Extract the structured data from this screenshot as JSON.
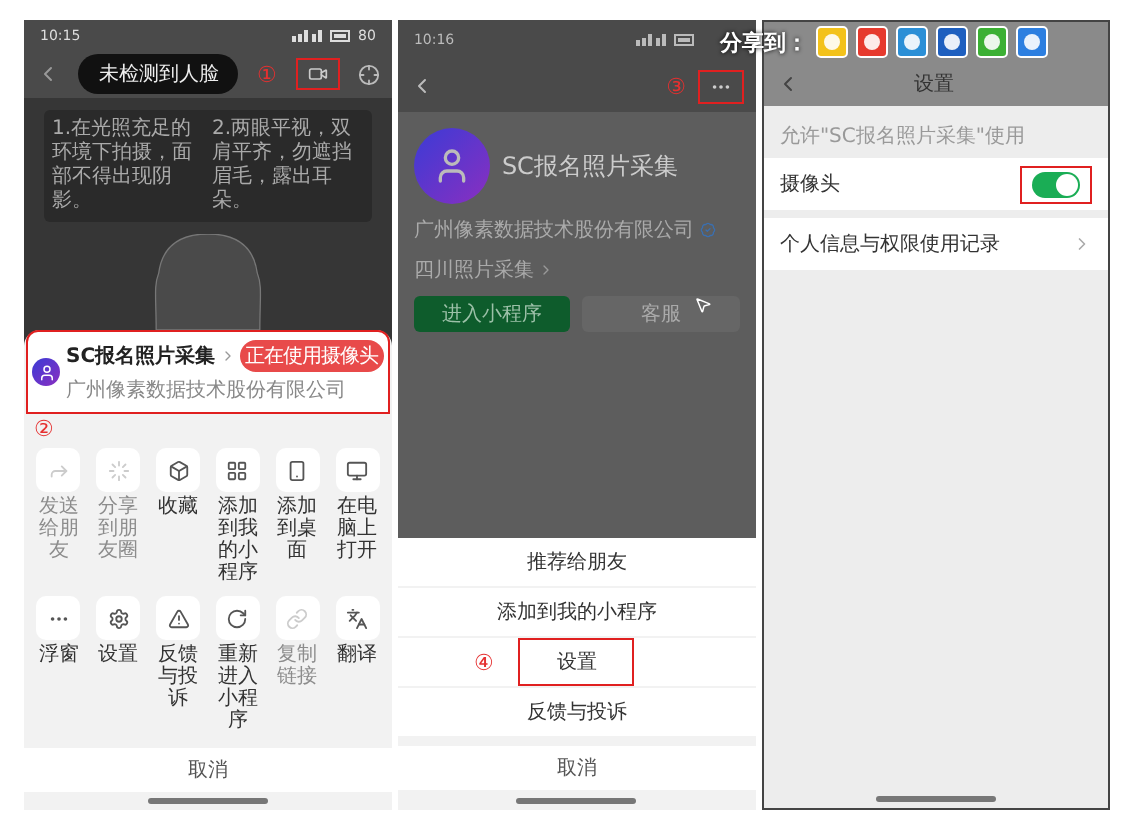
{
  "share_bar": {
    "label": "分享到："
  },
  "face_capture": {
    "status_time": "10:15",
    "battery": "80",
    "prompt": "未检测到人脸",
    "marker": "①",
    "tips": [
      "1.在光照充足的环境下拍摄，面部不得出现阴影。",
      "2.两眼平视，双肩平齐，勿遮挡眉毛，露出耳朵。"
    ],
    "sheet": {
      "app_name": "SC报名照片采集",
      "company": "广州像素数据技术股份有限公司",
      "camera_badge": "正在使用摄像头",
      "marker": "②",
      "rows": [
        [
          {
            "label": "发送给朋友",
            "disabled": true
          },
          {
            "label": "分享到朋友圈",
            "disabled": true
          },
          {
            "label": "收藏",
            "disabled": false
          },
          {
            "label": "添加到我的小程序",
            "disabled": false
          },
          {
            "label": "添加到桌面",
            "disabled": false
          },
          {
            "label": "在电脑上打开",
            "disabled": false
          }
        ],
        [
          {
            "label": "浮窗",
            "disabled": false
          },
          {
            "label": "设置",
            "disabled": false
          },
          {
            "label": "反馈与投诉",
            "disabled": false
          },
          {
            "label": "重新进入小程序",
            "disabled": false
          },
          {
            "label": "复制链接",
            "disabled": true
          },
          {
            "label": "翻译",
            "disabled": false
          }
        ]
      ],
      "cancel": "取消"
    }
  },
  "profile": {
    "status_time": "10:16",
    "marker": "③",
    "app_name": "SC报名照片采集",
    "company": "广州像素数据技术股份有限公司",
    "related": "四川照片采集",
    "enter_button": "进入小程序",
    "service_button": "客服",
    "menu": [
      {
        "label": "推荐给朋友",
        "highlighted": false
      },
      {
        "label": "添加到我的小程序",
        "highlighted": false
      },
      {
        "label": "设置",
        "highlighted": true
      },
      {
        "label": "反馈与投诉",
        "highlighted": false
      }
    ],
    "menu_marker": "④",
    "cancel": "取消"
  },
  "settings": {
    "title": "设置",
    "caption": "允许\"SC报名照片采集\"使用",
    "rows": [
      {
        "kind": "toggle",
        "label": "摄像头",
        "on": true
      },
      {
        "kind": "link",
        "label": "个人信息与权限使用记录"
      }
    ]
  }
}
